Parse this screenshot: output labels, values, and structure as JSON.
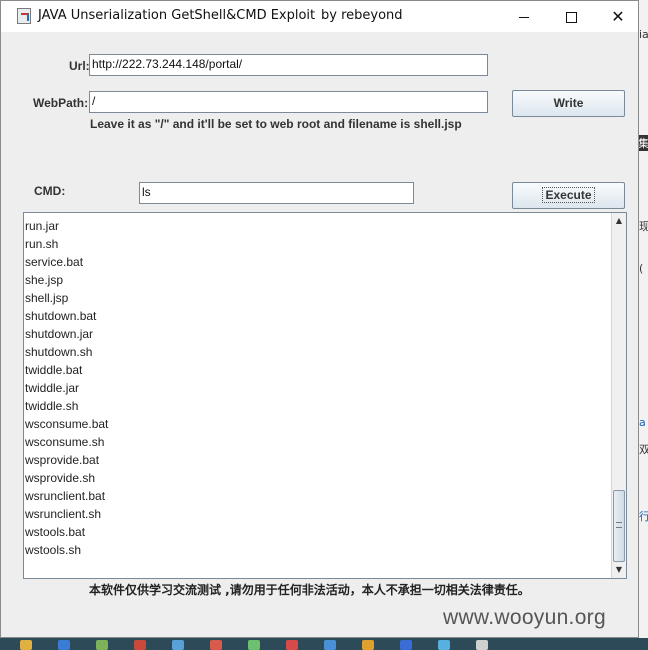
{
  "window": {
    "title": "JAVA Unserialization GetShell&CMD Exploit",
    "author": "by rebeyond",
    "controls": {
      "minimize": "",
      "maximize": "",
      "close": "✕"
    }
  },
  "form": {
    "url_label": "Url:",
    "url_value": "http://222.73.244.148/portal/",
    "webpath_label": "WebPath:",
    "webpath_value": "/",
    "write_button": "Write",
    "hint": "Leave it as \"/\" and it'll be set to web root and filename is shell.jsp",
    "cmd_label": "CMD:",
    "cmd_value": "ls",
    "execute_button": "Execute"
  },
  "output": {
    "lines": [
      "run.jar",
      "run.sh",
      "service.bat",
      "she.jsp",
      "shell.jsp",
      "shutdown.bat",
      "shutdown.jar",
      "shutdown.sh",
      "twiddle.bat",
      "twiddle.jar",
      "twiddle.sh",
      "wsconsume.bat",
      "wsconsume.sh",
      "wsprovide.bat",
      "wsprovide.sh",
      "wsrunclient.bat",
      "wsrunclient.sh",
      "wstools.bat",
      "wstools.sh"
    ],
    "scroll_up": "▲",
    "scroll_down": "▼"
  },
  "disclaimer": "本软件仅供学习交流测试 ,请勿用于任何非法活动，本人不承担一切相关法律责任。",
  "watermark": "www.wooyun.org",
  "background_fragments": [
    "ia",
    "集",
    "现",
    "(",
    "a",
    "双",
    "行"
  ],
  "colors": {
    "accent_border": "#7a8a99",
    "taskbar": "#2d4a58"
  }
}
